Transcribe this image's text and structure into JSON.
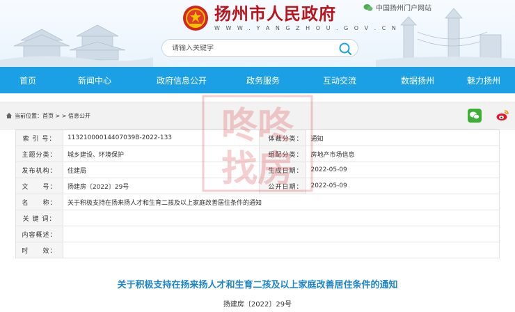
{
  "header": {
    "portal_link": "中国扬州门户网站",
    "site_title": "扬州市人民政府",
    "site_url": "W W W . Y A N G Z H O U . G O V . C N",
    "search_placeholder": "请输入关键字"
  },
  "nav": {
    "items": [
      "首页",
      "新闻中心",
      "政府信息公开",
      "政务服务",
      "互动交流",
      "数据扬州",
      "魅力扬州"
    ]
  },
  "breadcrumb": {
    "prefix": "当前位置：",
    "home": "首页",
    "sep": " > > ",
    "current": "信息公开"
  },
  "info": {
    "rows": [
      {
        "label": "索 引 号：",
        "value": "11321000014407039B-2022-133",
        "label2": "体裁分类：",
        "value2": "通知"
      },
      {
        "label": "主题分类：",
        "value": "城乡建设、环境保护",
        "label2": "组配分类：",
        "value2": "房地产市场信息"
      },
      {
        "label": "发布机构：",
        "value": "住建局",
        "label2": "生成日期：",
        "value2": "2022-05-09"
      },
      {
        "label": "文　　号：",
        "value": "扬建房〔2022〕29号",
        "label2": "公开日期：",
        "value2": "2022-05-09"
      }
    ],
    "name_label": "名　　称：",
    "name_value": "关于积极支持在扬来扬人才和生育二孩及以上家庭改善居住条件的通知",
    "keywords_label": "关 键 词：",
    "keywords_value": "",
    "summary_label": "内容概述：",
    "summary_value": "",
    "effect_label": "时　　效：",
    "effect_value": ""
  },
  "watermark": {
    "line1": "咚咚",
    "line2": "找房"
  },
  "article": {
    "title": "关于积极支持在扬来扬人才和生育二孩及以上家庭改善居住条件的通知",
    "doc_number": "扬建房〔2022〕29号"
  },
  "colors": {
    "nav_bg": "#1b9fe5",
    "title_red": "#b8141b",
    "article_title": "#1e84c8"
  }
}
